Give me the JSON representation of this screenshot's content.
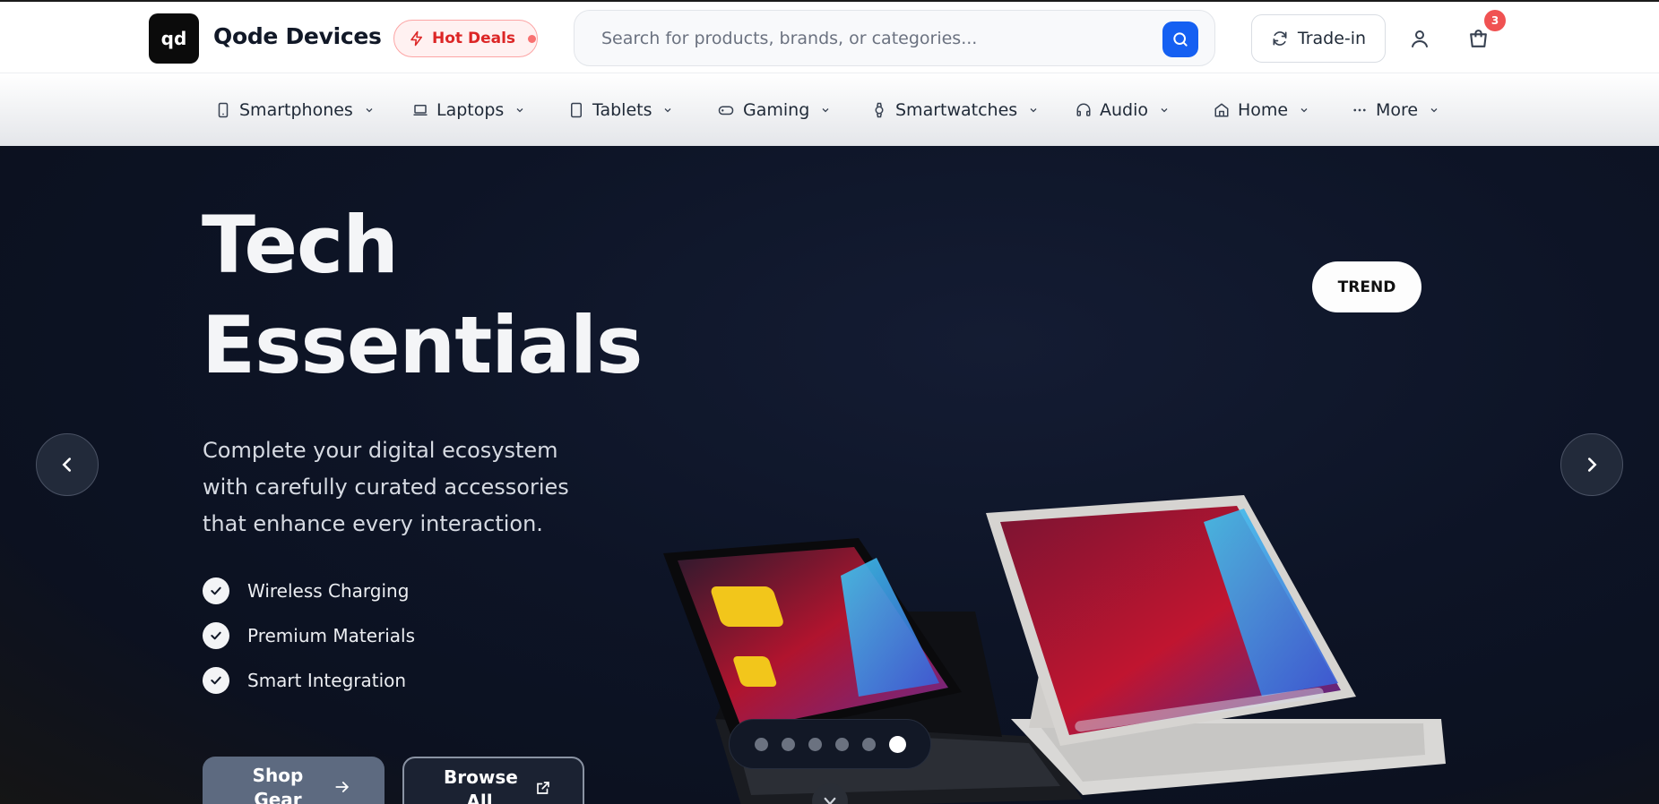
{
  "header": {
    "logo_text": "qd",
    "brand": "Qode Devices",
    "hot_deals": "Hot Deals",
    "search_placeholder": "Search for products, brands, or categories...",
    "trade_in": "Trade-in",
    "cart_count": "3"
  },
  "nav": [
    {
      "label": "Smartphones",
      "icon": "smartphone-icon"
    },
    {
      "label": "Laptops",
      "icon": "laptop-icon"
    },
    {
      "label": "Tablets",
      "icon": "tablet-icon"
    },
    {
      "label": "Gaming",
      "icon": "gamepad-icon"
    },
    {
      "label": "Smartwatches",
      "icon": "watch-icon"
    },
    {
      "label": "Audio",
      "icon": "headphones-icon"
    },
    {
      "label": "Home",
      "icon": "home-icon"
    },
    {
      "label": "More",
      "icon": "ellipsis-icon"
    }
  ],
  "hero": {
    "title_line1": "Tech",
    "title_line2": "Essentials",
    "description": "Complete your digital ecosystem with carefully curated accessories that enhance every interaction.",
    "features": [
      "Wireless Charging",
      "Premium Materials",
      "Smart Integration"
    ],
    "primary_button": "Shop Gear",
    "secondary_button": "Browse All",
    "badge": "TREND",
    "slides_total": 6,
    "active_slide": 6
  },
  "colors": {
    "accent": "#1560f2",
    "hot": "#dc2626",
    "badge": "#f05252",
    "hero_bg": "#0e1424"
  }
}
